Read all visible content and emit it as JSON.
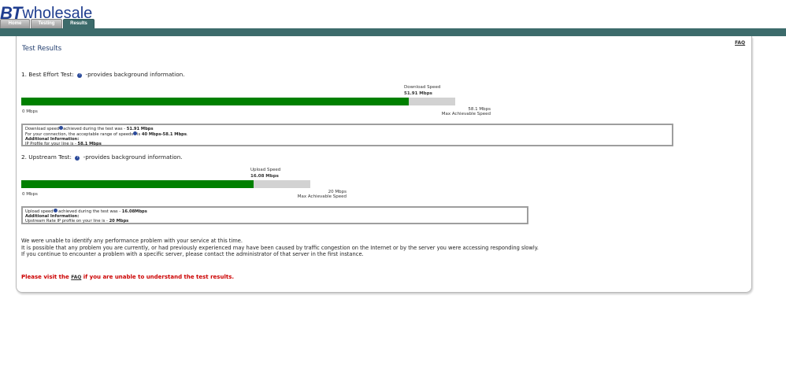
{
  "logo": {
    "bt": "BT",
    "word": "wholesale"
  },
  "tabs": [
    {
      "label": "Home"
    },
    {
      "label": "Testing"
    },
    {
      "label": "Results"
    }
  ],
  "faq_link": "FAQ",
  "title": "Test Results",
  "best_effort": {
    "heading_prefix": "1. Best Effort Test:",
    "heading_suffix": "-provides background information.",
    "bar_label": "Download Speed",
    "bar_value": "51.91 Mbps",
    "measured_mbps": 51.91,
    "max_mbps": 58.1,
    "zero_label": "0 Mbps",
    "max_label": "58.1 Mbps",
    "max_caption": "Max Achievable Speed",
    "info": {
      "l1_prefix": "Download speed",
      "l1_mid": "achieved during the test was - ",
      "l1_value": "51.91 Mbps",
      "l2_prefix": "For your connection, the acceptable range of speeds",
      "l2_mid": "is ",
      "l2_value": "40 Mbps-58.1 Mbps",
      "l2_suffix": ".",
      "l3": "Additional Information:",
      "l4_prefix": "IP Profile for your line is - ",
      "l4_value": "58.1 Mbps"
    }
  },
  "upstream": {
    "heading_prefix": "2. Upstream Test:",
    "heading_suffix": "-provides background information.",
    "bar_label": "Upload Speed",
    "bar_value": "16.08 Mbps",
    "measured_mbps": 16.08,
    "max_mbps": 20,
    "zero_label": "0 Mbps",
    "max_label": "20 Mbps",
    "max_caption": "Max Achievable Speed",
    "info": {
      "l1_prefix": "Upload speed",
      "l1_mid": " achieved during the test was - ",
      "l1_value": "16.08Mbps",
      "l2": "Additional Information:",
      "l3_prefix": "Upstream Rate IP profile on your line is - ",
      "l3_value": "20 Mbps"
    }
  },
  "message": {
    "line1": "We were unable to identify any performance problem with your service at this time.",
    "line2": "It is possible that any problem you are currently, or had previously experienced may have been caused by traffic congestion on the Internet or by the server you were accessing responding slowly.",
    "line3": "If you continue to encounter a problem with a specific server, please contact the administrator of that server in the first instance."
  },
  "faq_note": {
    "prefix": "Please visit the ",
    "link": "FAQ",
    "suffix": " if you are unable to understand the test results."
  },
  "colors": {
    "brand_blue": "#1f3d8f",
    "band_teal": "#3c6b6b",
    "bar_green": "#008000",
    "bar_track": "#d2d2d2",
    "warning_red": "#cc0000"
  }
}
